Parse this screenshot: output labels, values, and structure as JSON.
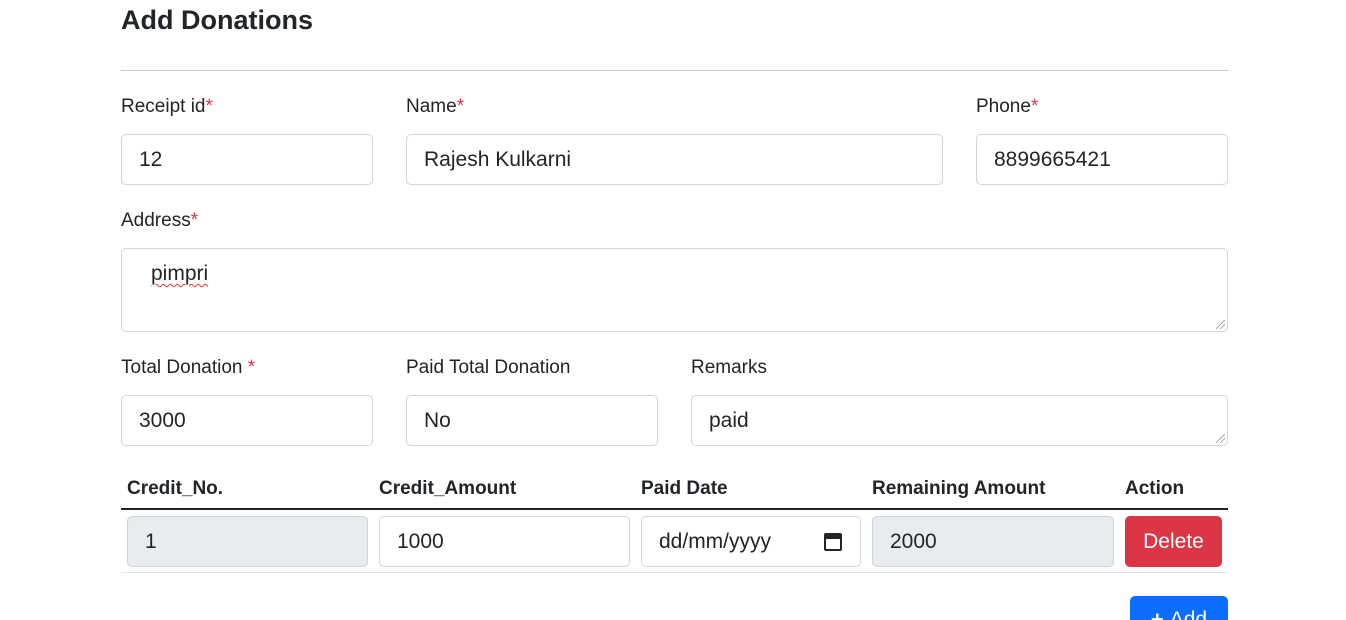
{
  "page": {
    "title": "Add Donations"
  },
  "form": {
    "receipt_id": {
      "label": "Receipt id",
      "required_mark": "*",
      "value": "12"
    },
    "name": {
      "label": "Name",
      "required_mark": "*",
      "value": "Rajesh Kulkarni"
    },
    "phone": {
      "label": "Phone",
      "required_mark": "*",
      "value": "8899665421"
    },
    "address": {
      "label": "Address",
      "required_mark": "*",
      "value": "pimpri"
    },
    "total_donation": {
      "label": "Total Donation ",
      "required_mark": "*",
      "value": "3000"
    },
    "paid_total_donation": {
      "label": "Paid Total Donation",
      "value": "No"
    },
    "remarks": {
      "label": "Remarks",
      "value": "paid"
    }
  },
  "credits_table": {
    "headers": [
      "Credit_No.",
      "Credit_Amount",
      "Paid Date",
      "Remaining Amount",
      "Action"
    ],
    "rows": [
      {
        "credit_no": "1",
        "credit_amount": "1000",
        "paid_date_placeholder": "dd/mm/yyyy",
        "remaining_amount": "2000",
        "action_label": "Delete"
      }
    ]
  },
  "actions": {
    "add_label": "Add"
  },
  "colors": {
    "required": "#dc3545",
    "delete_button": "#dc3545",
    "add_button": "#0d6efd",
    "readonly_field": "#e9ecef"
  }
}
